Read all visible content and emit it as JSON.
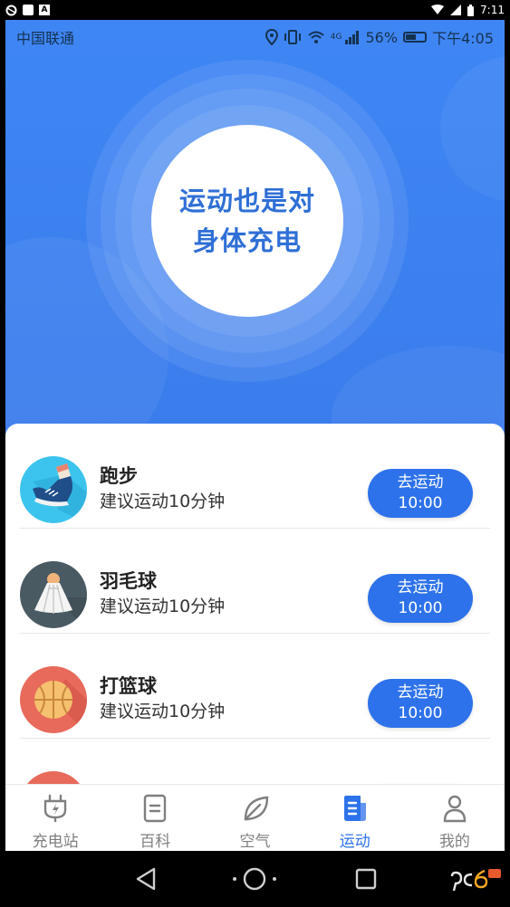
{
  "device": {
    "time": "7:11"
  },
  "status_bar": {
    "carrier": "中国联通",
    "network": "4G",
    "battery": "56%",
    "time": "下午4:05"
  },
  "hero": {
    "line1": "运动也是对",
    "line2": "身体充电"
  },
  "activities": [
    {
      "title": "跑步",
      "subtitle": "建议运动10分钟",
      "button_label": "去运动",
      "button_time": "10:00",
      "icon": "running-shoe-icon",
      "icon_bg": "#3cc4ee"
    },
    {
      "title": "羽毛球",
      "subtitle": "建议运动10分钟",
      "button_label": "去运动",
      "button_time": "10:00",
      "icon": "badminton-shuttlecock-icon",
      "icon_bg": "#4a5a63"
    },
    {
      "title": "打篮球",
      "subtitle": "建议运动10分钟",
      "button_label": "去运动",
      "button_time": "10:00",
      "icon": "basketball-icon",
      "icon_bg": "#e86a5b"
    }
  ],
  "tabs": [
    {
      "label": "充电站",
      "icon": "charging-plug-icon",
      "active": false
    },
    {
      "label": "百科",
      "icon": "document-icon",
      "active": false
    },
    {
      "label": "空气",
      "icon": "leaf-icon",
      "active": false
    },
    {
      "label": "运动",
      "icon": "sports-note-icon",
      "active": true
    },
    {
      "label": "我的",
      "icon": "user-icon",
      "active": false
    }
  ],
  "colors": {
    "primary": "#2d72ea",
    "hero_bg": "#3d82f2",
    "inactive_tab": "#7f7f7f"
  }
}
